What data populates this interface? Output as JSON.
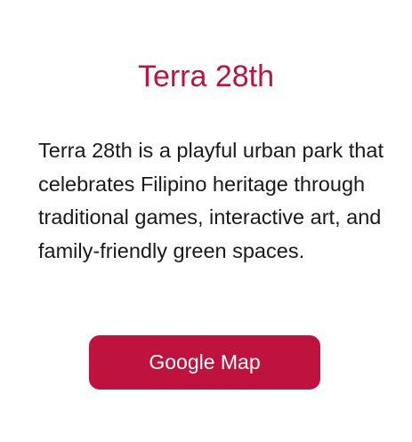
{
  "card": {
    "title": "Terra 28th",
    "description": "Terra 28th is a playful urban park that celebrates Filipino heritage through traditional games, interactive art, and family-friendly green spaces.",
    "button_label": "Google Map"
  },
  "colors": {
    "accent": "#c0123e",
    "text": "#1a1a1a",
    "background": "#ffffff",
    "button_text": "#ffffff"
  }
}
